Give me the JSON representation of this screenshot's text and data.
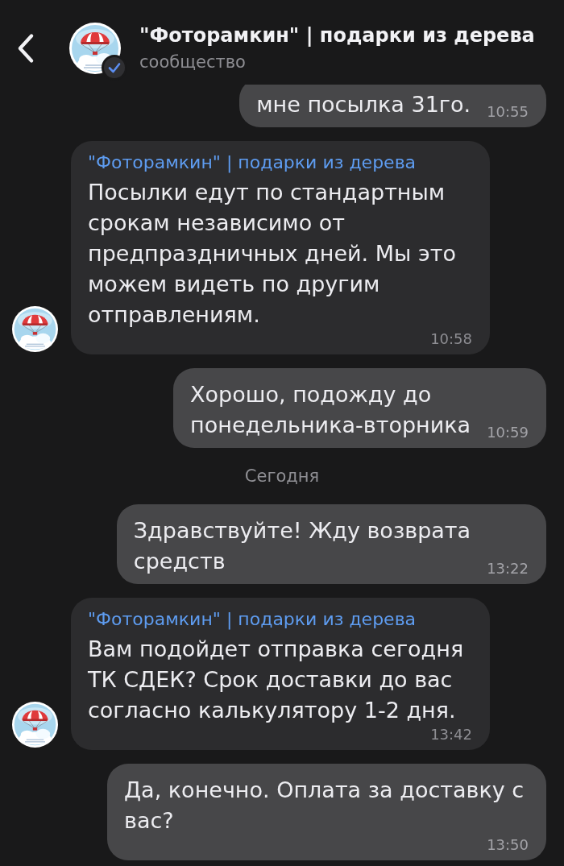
{
  "header": {
    "title": "\"Фоторамкин\" | подарки из дерева",
    "subtitle": "сообщество",
    "verified": true
  },
  "messages": [
    {
      "kind": "outgoing",
      "text": "мне посылка 31го.",
      "time": "10:55"
    },
    {
      "kind": "incoming",
      "sender": "\"Фоторамкин\" | подарки из дерева",
      "text": "Посылки едут по стандартным\nсрокам независимо от\nпредпраздничных дней. Мы это\nможем видеть по другим\nотправлениям.",
      "time": "10:58"
    },
    {
      "kind": "outgoing",
      "text": "Хорошо, подожду до\nпонедельника-вторника",
      "time": "10:59"
    },
    {
      "kind": "date",
      "text": "Сегодня"
    },
    {
      "kind": "outgoing",
      "text": "Здравствуйте! Жду возврата\nсредств",
      "time": "13:22"
    },
    {
      "kind": "incoming",
      "sender": "\"Фоторамкин\" | подарки из дерева",
      "text": "Вам подойдет отправка сегодня\nТК СДЕК? Срок доставки до вас\nсогласно калькулятору 1-2 дня.",
      "time": "13:42"
    },
    {
      "kind": "outgoing",
      "text": "Да, конечно. Оплата за доставку с\nвас?",
      "time": "13:50"
    }
  ]
}
